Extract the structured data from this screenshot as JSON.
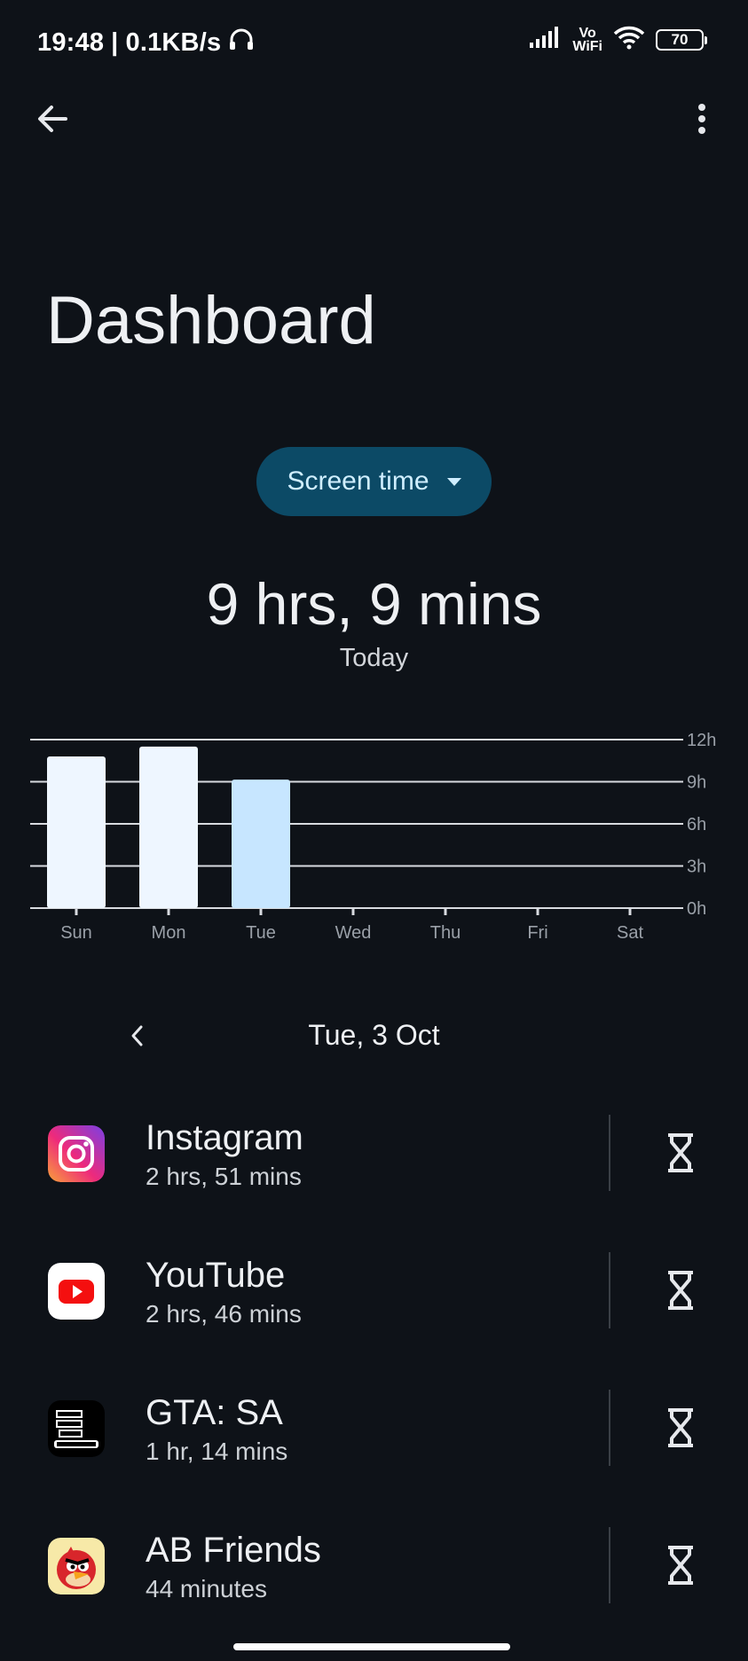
{
  "status_bar": {
    "time": "19:48",
    "separator": "|",
    "net_speed": "0.1KB/s",
    "volte_top": "Vo",
    "volte_bottom": "WiFi",
    "battery": "70"
  },
  "header": {
    "title": "Dashboard",
    "back_icon": "arrow-back-icon",
    "more_icon": "more-vert-icon"
  },
  "metric_selector": {
    "label": "Screen time"
  },
  "summary": {
    "total": "9 hrs, 9 mins",
    "caption": "Today"
  },
  "chart_data": {
    "type": "bar",
    "categories": [
      "Sun",
      "Mon",
      "Tue",
      "Wed",
      "Thu",
      "Fri",
      "Sat"
    ],
    "values": [
      10.8,
      11.5,
      9.15,
      0,
      0,
      0,
      0
    ],
    "y_tick_labels": [
      "0h",
      "3h",
      "6h",
      "9h",
      "12h"
    ],
    "y_ticks": [
      0,
      3,
      6,
      9,
      12
    ],
    "ylim": [
      0,
      12
    ],
    "highlight_index": 2,
    "bar_color": "#eef6ff",
    "highlight_color": "#c7e6ff",
    "grid": true
  },
  "day_nav": {
    "label": "Tue, 3 Oct"
  },
  "apps": [
    {
      "name": "Instagram",
      "usage": "2 hrs, 51 mins",
      "icon": "instagram-icon"
    },
    {
      "name": "YouTube",
      "usage": "2 hrs, 46 mins",
      "icon": "youtube-icon"
    },
    {
      "name": "GTA: SA",
      "usage": "1 hr, 14 mins",
      "icon": "gta-sa-icon"
    },
    {
      "name": "AB Friends",
      "usage": "44 minutes",
      "icon": "ab-friends-icon"
    }
  ],
  "colors": {
    "background": "#0e1218",
    "accent_chip": "#0c4a66",
    "chip_text": "#cfeeff"
  }
}
